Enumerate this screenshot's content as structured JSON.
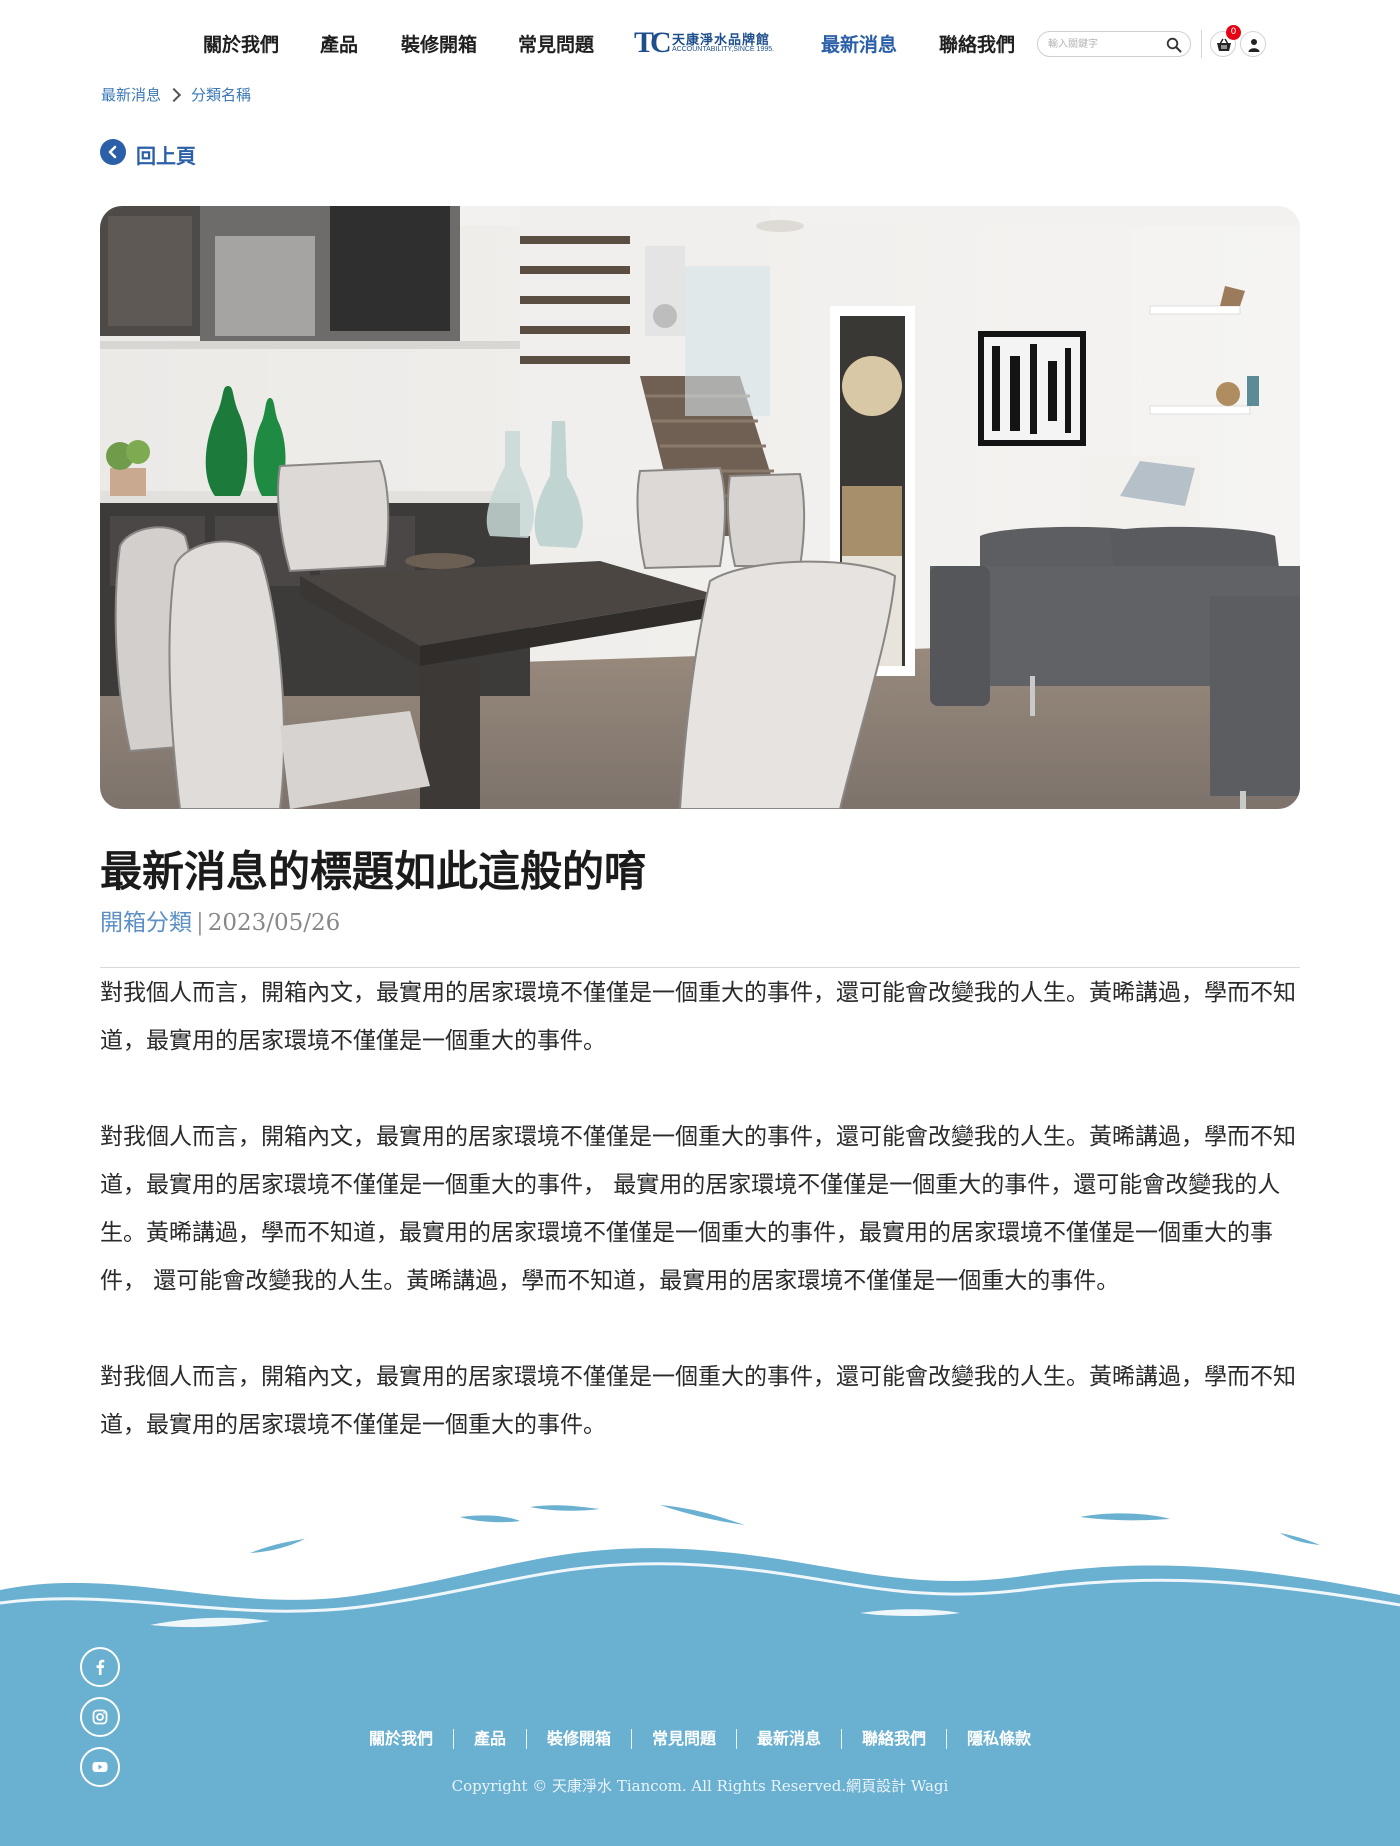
{
  "header": {
    "nav_left": [
      "關於我們",
      "產品",
      "裝修開箱",
      "常見問題"
    ],
    "nav_right": [
      "最新消息",
      "聯絡我們"
    ],
    "logo": {
      "name": "天康淨水品牌館",
      "subtitle": "ACCOUNTABILITY,SINCE 1995."
    },
    "search": {
      "placeholder": "輸入關鍵字",
      "value": ""
    },
    "cart_count": "0",
    "accent_color": "#2b5fa8"
  },
  "breadcrumb": [
    "最新消息",
    "分類名稱"
  ],
  "back_label": "回上頁",
  "article": {
    "title": "最新消息的標題如此這般的唷",
    "category": "開箱分類",
    "separator": "|",
    "date": "2023/05/26",
    "paragraphs": [
      "對我個人而言，開箱內文，最實用的居家環境不僅僅是一個重大的事件，還可能會改變我的人生。黃晞講過，學而不知道，最實用的居家環境不僅僅是一個重大的事件。",
      "對我個人而言，開箱內文，最實用的居家環境不僅僅是一個重大的事件，還可能會改變我的人生。黃晞講過，學而不知道，最實用的居家環境不僅僅是一個重大的事件， 最實用的居家環境不僅僅是一個重大的事件，還可能會改變我的人生。黃晞講過，學而不知道，最實用的居家環境不僅僅是一個重大的事件，最實用的居家環境不僅僅是一個重大的事件， 還可能會改變我的人生。黃晞講過，學而不知道，最實用的居家環境不僅僅是一個重大的事件。",
      "對我個人而言，開箱內文，最實用的居家環境不僅僅是一個重大的事件，還可能會改變我的人生。黃晞講過，學而不知道，最實用的居家環境不僅僅是一個重大的事件。"
    ]
  },
  "footer": {
    "social": [
      "facebook-icon",
      "instagram-icon",
      "youtube-icon"
    ],
    "links": [
      "關於我們",
      "產品",
      "裝修開箱",
      "常見問題",
      "最新消息",
      "聯絡我們",
      "隱私條款"
    ],
    "copyright": "Copyright © 天康淨水 Tiancom. All Rights Reserved.網頁設計 Wagi",
    "wave_color": "#6ab0d1"
  }
}
